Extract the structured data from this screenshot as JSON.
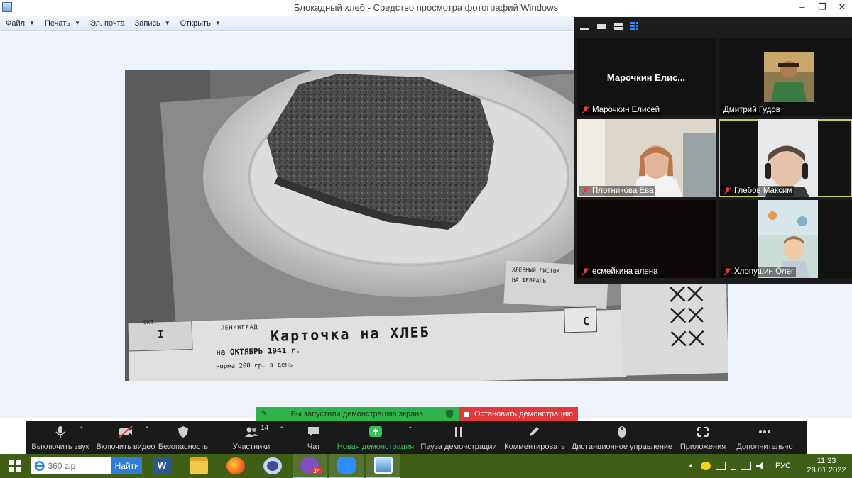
{
  "window": {
    "title": "Блокадный хлеб - Средство просмотра фотографий Windows",
    "controls": [
      "–",
      "❐",
      "✕"
    ]
  },
  "menu": [
    {
      "label": "Файл",
      "has_caret": true
    },
    {
      "label": "Печать",
      "has_caret": true
    },
    {
      "label": "Эл. почта",
      "has_caret": false
    },
    {
      "label": "Запись",
      "has_caret": true
    },
    {
      "label": "Открыть",
      "has_caret": true
    }
  ],
  "photo": {
    "card_city": "ЛЕНИНГРАД",
    "card_title": "Карточка на ХЛЕБ",
    "card_month": "на ОКТЯБРЬ 1941 г.",
    "card_norm": "норма 200 гр. в день",
    "card_label": "ОКТ.",
    "card_number": "I",
    "card_letter": "С",
    "card2_line1": "ХЛЕБНЫЙ ЛИСТОК",
    "card2_line2": "НА ФЕВРАЛЬ"
  },
  "participants": [
    {
      "name": "Марочкин Елисей",
      "big_name": "Марочкин  Елис...",
      "video": false,
      "muted": true,
      "active": false
    },
    {
      "name": "Дмитрий Гудов",
      "video": "avatar",
      "muted": false,
      "active": false
    },
    {
      "name": "Плотникова Ева",
      "video": "camera",
      "muted": true,
      "active": false
    },
    {
      "name": "Глебов Максим",
      "video": "camera",
      "muted": true,
      "active": true
    },
    {
      "name": "есмейкина алена",
      "video": false,
      "muted": true,
      "active": false
    },
    {
      "name": "Хлопушин Олег",
      "video": "camera",
      "muted": true,
      "active": false
    }
  ],
  "share_bar": {
    "message": "Вы запустили демонстрацию экрана",
    "stop_label": "Остановить демонстрацию",
    "message_color": "#2fb34c",
    "stop_color": "#e0383d"
  },
  "controls": [
    {
      "label": "Выключить звук",
      "icon": "microphone-icon",
      "chevron": true
    },
    {
      "label": "Включить видео",
      "icon": "video-off-icon",
      "chevron": true
    },
    {
      "label": "Безопасность",
      "icon": "shield-icon",
      "chevron": false
    },
    {
      "label": "Участники",
      "icon": "participants-icon",
      "chevron": true,
      "count": "14"
    },
    {
      "label": "Чат",
      "icon": "chat-icon",
      "chevron": false
    },
    {
      "label": "Новая демонстрация",
      "icon": "share-screen-icon",
      "chevron": true,
      "highlight": true
    },
    {
      "label": "Пауза демонстрации",
      "icon": "pause-icon",
      "chevron": false
    },
    {
      "label": "Комментировать",
      "icon": "pencil-icon",
      "chevron": false
    },
    {
      "label": "Дистанционное управление",
      "icon": "mouse-icon",
      "chevron": false
    },
    {
      "label": "Приложения",
      "icon": "apps-icon",
      "chevron": false
    },
    {
      "label": "Дополнительно",
      "icon": "more-icon",
      "chevron": false
    }
  ],
  "taskbar": {
    "search_placeholder": "360 zip",
    "search_button": "Найти",
    "apps": [
      "word-icon",
      "file-explorer-icon",
      "firefox-icon",
      "settings-icon",
      "viber-icon",
      "zoom-icon",
      "photo-viewer-icon"
    ],
    "viber_badge": "34",
    "language": "РУС",
    "time": "11:23",
    "date": "28.01.2022"
  },
  "colors": {
    "zoom_accent": "#2d8cff",
    "share_green": "#39c05a",
    "taskbar": "#3f5f16"
  }
}
